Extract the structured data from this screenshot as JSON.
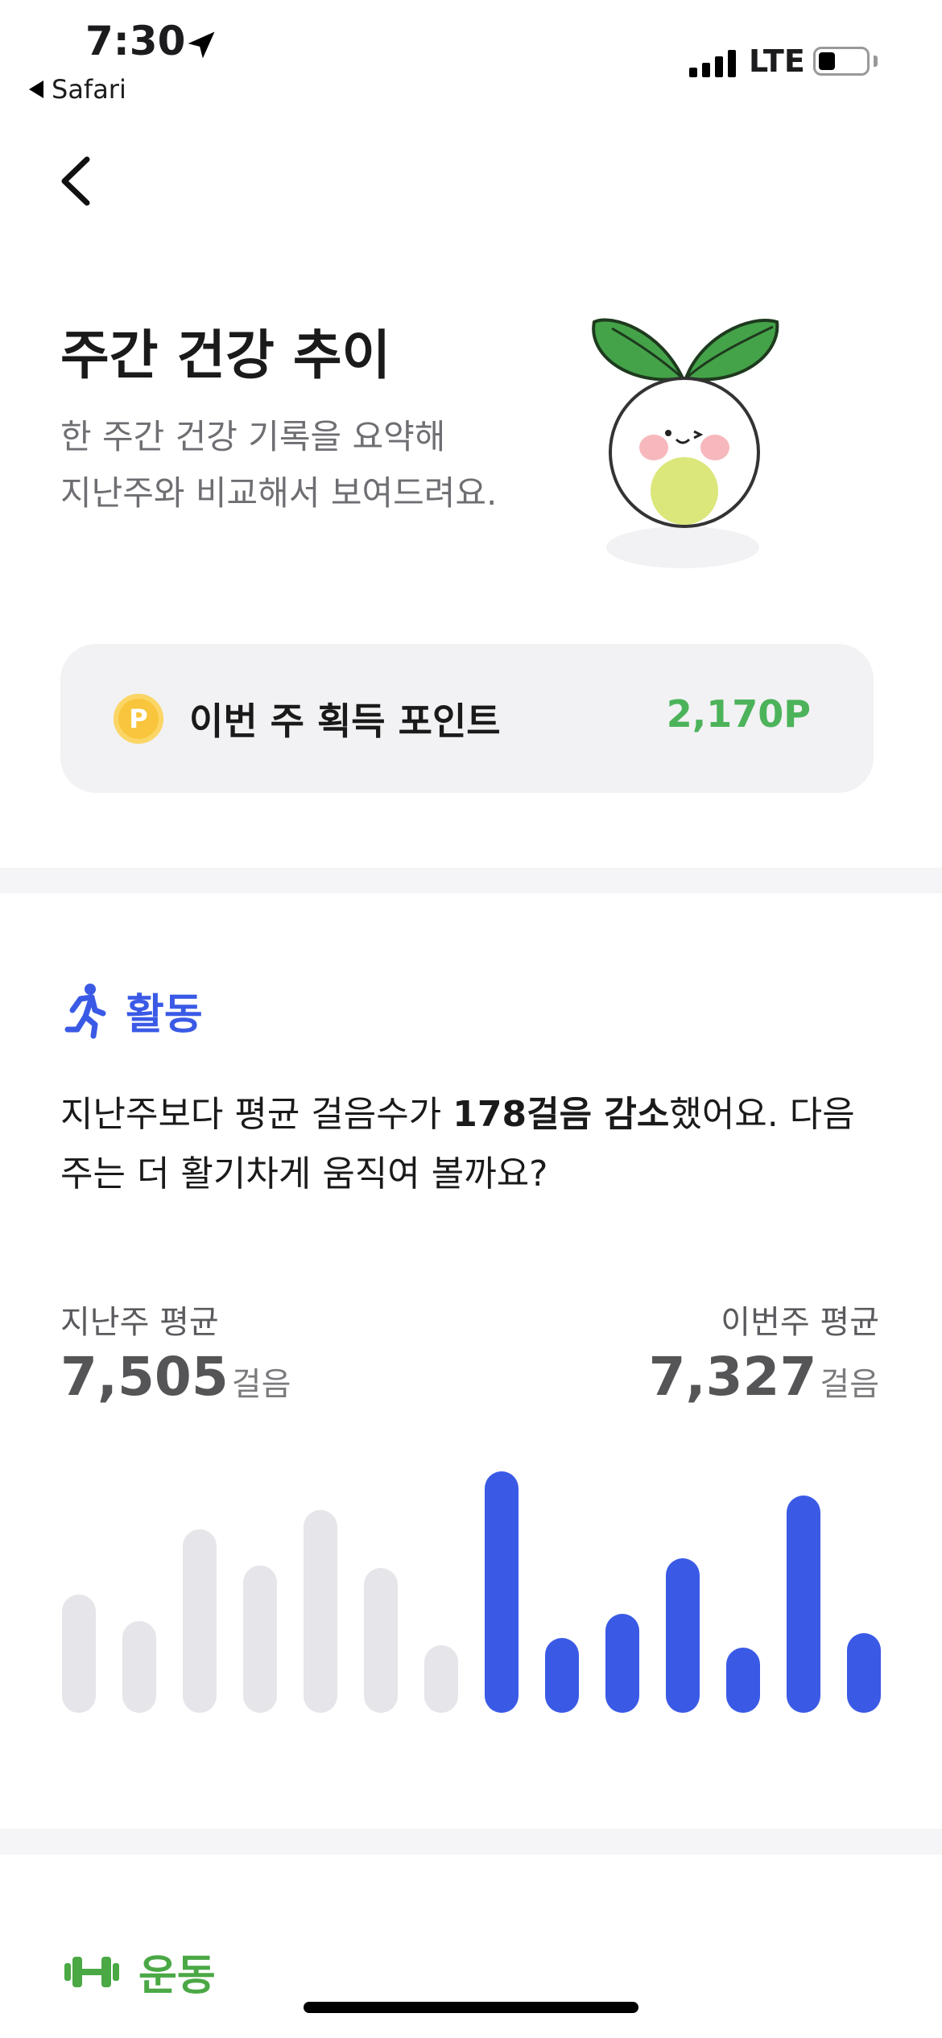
{
  "status_bar": {
    "time": "7:30",
    "back_app": "Safari",
    "network": "LTE",
    "icons": [
      "location-arrow-icon",
      "signal-icon",
      "battery-icon"
    ]
  },
  "header": {
    "back_icon": "chevron-left-icon",
    "title": "주간 건강 추이",
    "subtitle_line1": "한 주간 건강 기록을 요약해",
    "subtitle_line2": "지난주와 비교해서 보여드려요.",
    "mascot_icon": "sprout-character-icon"
  },
  "points": {
    "coin_letter": "P",
    "label": "이번 주 획득 포인트",
    "value": "2,170P",
    "value_color": "#4cb35a"
  },
  "activity": {
    "icon": "running-person-icon",
    "title": "활동",
    "color": "#3a5ae6",
    "desc_prefix": "지난주보다 평균 걸음수가 ",
    "desc_bold": "178걸음 감소",
    "desc_suffix": "했어요. 다음 주는 더 활기차게 움직여 볼까요?",
    "last_week_label": "지난주 평균",
    "last_week_value": "7,505",
    "this_week_label": "이번주 평균",
    "this_week_value": "7,327",
    "unit": "걸음"
  },
  "chart_data": {
    "type": "bar",
    "series": [
      {
        "values": [
          0.49,
          0.38,
          0.76,
          0.61,
          0.84,
          0.6,
          0.28
        ],
        "color": "#e5e5ea"
      },
      {
        "values": [
          1.0,
          0.31,
          0.41,
          0.64,
          0.27,
          0.9,
          0.33
        ],
        "color": "#3a5ae6"
      }
    ]
  },
  "exercise": {
    "icon": "dumbbell-icon",
    "title": "운동",
    "color": "#4aa845"
  }
}
